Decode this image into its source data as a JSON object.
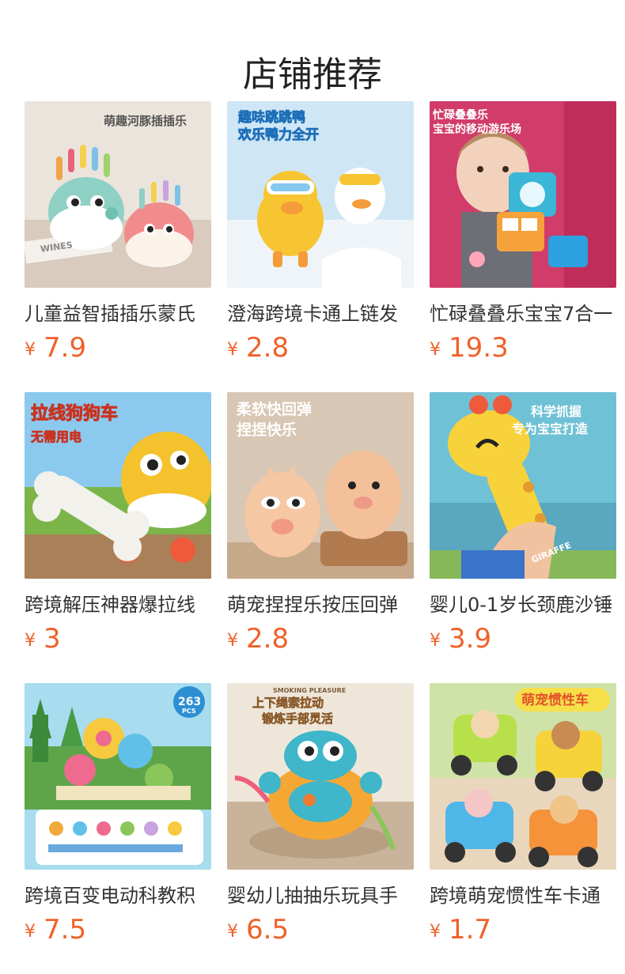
{
  "page": {
    "title": "店铺推荐"
  },
  "theme": {
    "price_color": "#f0612a",
    "text_color": "#333333"
  },
  "products": [
    {
      "name": "儿童益智插插乐蒙氏",
      "currency": "¥",
      "price": "7.9",
      "image_icon": "pufferfish-toy-image",
      "image_text": [
        "萌趣河豚插插乐",
        "WINES"
      ]
    },
    {
      "name": "澄海跨境卡通上链发",
      "currency": "¥",
      "price": "2.8",
      "image_icon": "wind-up-duck-toy-image",
      "image_text": [
        "趣味跳跳鸭",
        "欢乐鸭力全开"
      ]
    },
    {
      "name": "忙碌叠叠乐宝宝7合一",
      "currency": "¥",
      "price": "19.3",
      "image_icon": "baby-busy-cube-image",
      "image_text": [
        "忙碌叠叠乐",
        "宝宝的移动游乐场"
      ]
    },
    {
      "name": "跨境解压神器爆拉线",
      "currency": "¥",
      "price": "3",
      "image_icon": "pull-string-dog-car-image",
      "image_text": [
        "拉线狗狗车",
        "无需用电"
      ]
    },
    {
      "name": "萌宠捏捏乐按压回弹",
      "currency": "¥",
      "price": "2.8",
      "image_icon": "squishy-toy-image",
      "image_text": [
        "柔软快回弹",
        "捏捏快乐"
      ]
    },
    {
      "name": "婴儿0-1岁长颈鹿沙锤",
      "currency": "¥",
      "price": "3.9",
      "image_icon": "giraffe-rattle-image",
      "image_text": [
        "科学抓握",
        "专为宝宝打造",
        "GIRAFFE"
      ]
    },
    {
      "name": "跨境百变电动科教积",
      "currency": "¥",
      "price": "7.5",
      "image_icon": "gear-building-blocks-image",
      "image_text": [
        "263",
        "PCS"
      ]
    },
    {
      "name": "婴幼儿抽抽乐玩具手",
      "currency": "¥",
      "price": "6.5",
      "image_icon": "crab-pull-string-toy-image",
      "image_text": [
        "SMOKING PLEASURE",
        "上下绳索拉动",
        "锻炼手部灵活"
      ]
    },
    {
      "name": "跨境萌宠惯性车卡通",
      "currency": "¥",
      "price": "1.7",
      "image_icon": "inertia-car-toys-image",
      "image_text": [
        "萌宠惯性车"
      ]
    }
  ]
}
